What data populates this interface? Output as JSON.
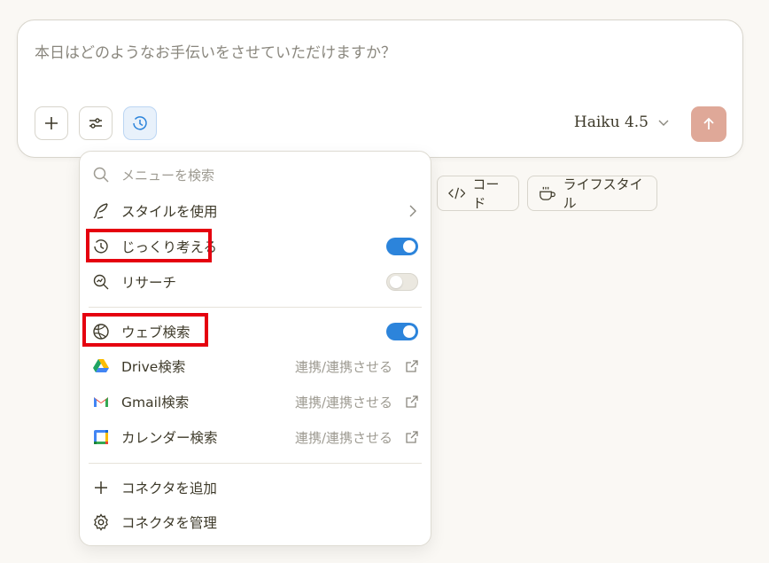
{
  "composer": {
    "placeholder": "本日はどのようなお手伝いをさせていただけますか？",
    "model_label": "Haiku 4.5"
  },
  "chips": [
    {
      "label": "コード",
      "icon": "code-icon"
    },
    {
      "label": "ライフスタイル",
      "icon": "coffee-cup-icon"
    }
  ],
  "menu": {
    "search_placeholder": "メニューを検索",
    "style_item": "スタイルを使用",
    "think_item": {
      "label": "じっくり考える",
      "enabled": true
    },
    "research_item": {
      "label": "リサーチ",
      "enabled": false
    },
    "web_search_item": {
      "label": "ウェブ検索",
      "enabled": true
    },
    "connectors": [
      {
        "label": "Drive検索",
        "action": "連携/連携させる",
        "icon": "google-drive-icon"
      },
      {
        "label": "Gmail検索",
        "action": "連携/連携させる",
        "icon": "gmail-icon"
      },
      {
        "label": "カレンダー検索",
        "action": "連携/連携させる",
        "icon": "google-calendar-icon"
      }
    ],
    "add_connector": "コネクタを追加",
    "manage_connectors": "コネクタを管理"
  },
  "colors": {
    "toggle_on": "#2c84db",
    "send_button": "#dfa898",
    "highlight": "#e5000f"
  }
}
